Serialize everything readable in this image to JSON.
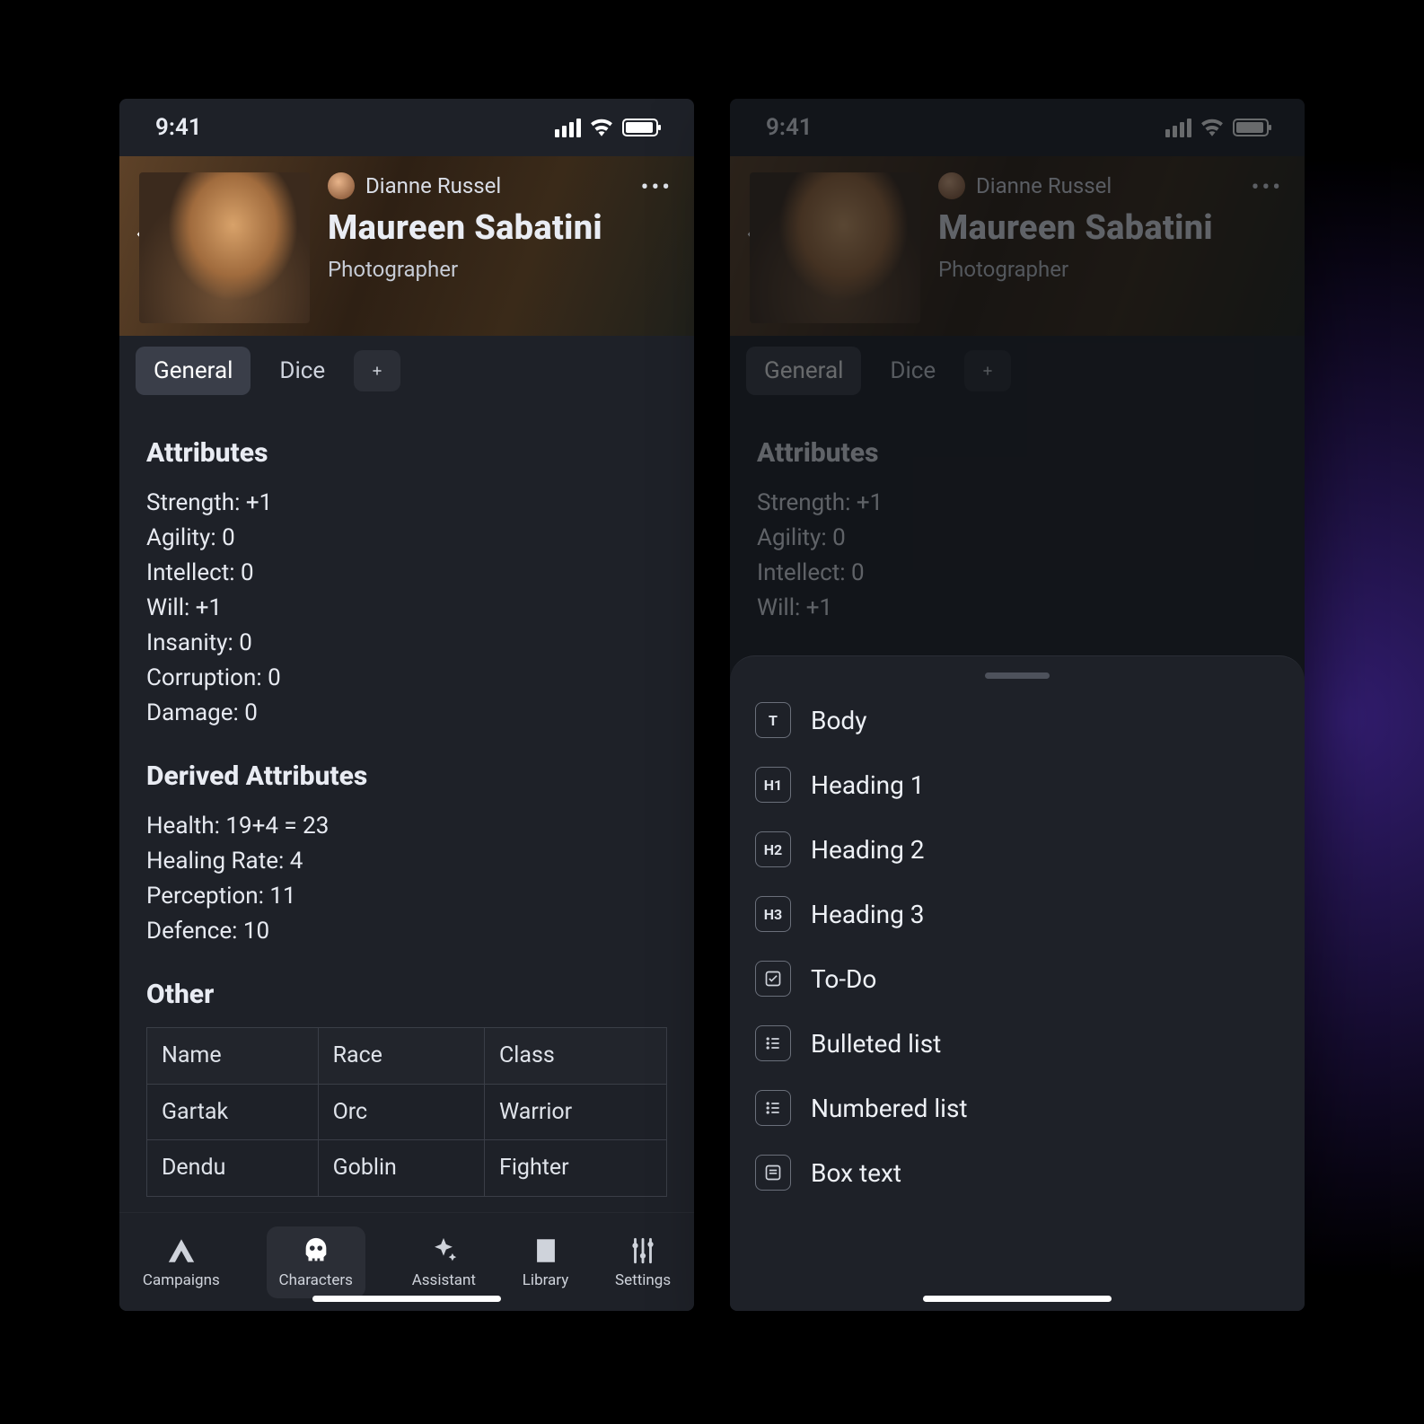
{
  "status": {
    "time": "9:41"
  },
  "header": {
    "owner": "Dianne Russel",
    "title": "Maureen Sabatini",
    "subtitle": "Photographer"
  },
  "tabs": {
    "general": "General",
    "dice": "Dice"
  },
  "sections": {
    "attributes_title": "Attributes",
    "attributes": {
      "strength": "Strength: +1",
      "agility": "Agility: 0",
      "intellect": "Intellect:  0",
      "will": "Will:  +1",
      "insanity": "Insanity: 0",
      "corruption": "Corruption: 0",
      "damage": "Damage: 0"
    },
    "derived_title": "Derived Attributes",
    "derived": {
      "health": "Health: 19+4 = 23",
      "healing": "Healing Rate: 4",
      "perception": "Perception: 11",
      "defence": "Defence: 10"
    },
    "other_title": "Other",
    "table": {
      "h1": "Name",
      "h2": "Race",
      "h3": "Class",
      "r1c1": "Gartak",
      "r1c2": "Orc",
      "r1c3": "Warrior",
      "r2c1": "Dendu",
      "r2c2": "Goblin",
      "r2c3": "Fighter"
    }
  },
  "nav": {
    "campaigns": "Campaigns",
    "characters": "Characters",
    "assistant": "Assistant",
    "library": "Library",
    "settings": "Settings"
  },
  "sheet": {
    "body": "Body",
    "h1": "Heading 1",
    "h2": "Heading 2",
    "h3": "Heading 3",
    "todo": "To-Do",
    "bullet": "Bulleted list",
    "number": "Numbered list",
    "box": "Box text"
  },
  "badges": {
    "t": "T",
    "h1": "H1",
    "h2": "H2",
    "h3": "H3"
  }
}
